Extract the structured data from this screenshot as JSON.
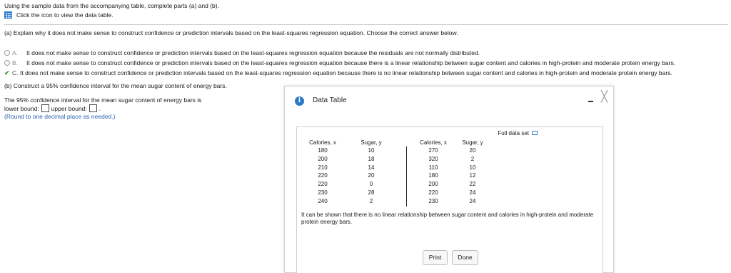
{
  "intro": {
    "instruction": "Using the sample data from the accompanying table, complete parts (a) and (b).",
    "click_text": "Click the icon to view the data table."
  },
  "part_a": {
    "question": "(a) Explain why it does not make sense to construct confidence or prediction intervals based on the least-squares regression equation. Choose the correct answer below.",
    "options": [
      {
        "letter": "A.",
        "text": "It does not make sense to construct confidence or prediction intervals based on the least-squares regression equation because the residuals are not normally distributed.",
        "selected": false
      },
      {
        "letter": "B.",
        "text": "It does not make sense to construct confidence or prediction intervals based on the least-squares regression equation because there is a linear relationship between sugar content and calories in high-protein and moderate protein energy bars.",
        "selected": false
      },
      {
        "letter": "C.",
        "text": "It does not make sense to construct confidence or prediction intervals based on the least-squares regression equation because there is no linear relationship between sugar content and calories in high-protein and moderate protein energy bars.",
        "selected": true
      }
    ]
  },
  "part_b": {
    "title": "(b) Construct a 95% confidence interval for the mean sugar content of energy bars.",
    "ci_text": "The 95% confidence interval for the mean sugar content of energy bars is",
    "lower_label": "lower bound:",
    "upper_label": "upper bound:",
    "period": ".",
    "round_note": "(Round to one decimal place as needed.)"
  },
  "dialog": {
    "title": "Data Table",
    "info_glyph": "i",
    "close_glyph": "╳",
    "full_data_set": "Full data set",
    "table": {
      "headers": [
        "Calories, x",
        "Sugar, y",
        "Calories, x",
        "Sugar, y"
      ],
      "columns": [
        [
          "180",
          "200",
          "210",
          "220",
          "220",
          "230",
          "240"
        ],
        [
          "10",
          "18",
          "14",
          "20",
          "0",
          "28",
          "2"
        ],
        [
          "270",
          "320",
          "110",
          "180",
          "200",
          "220",
          "230"
        ],
        [
          "20",
          "2",
          "10",
          "12",
          "22",
          "24",
          "24"
        ]
      ]
    },
    "note": "It can be shown that there is no linear relationship between sugar content and calories in high-protein and moderate protein energy bars.",
    "print_label": "Print",
    "done_label": "Done"
  },
  "colors": {
    "accent": "#2a79c9",
    "check": "#3aa336",
    "note_blue": "#2a5fb0"
  }
}
